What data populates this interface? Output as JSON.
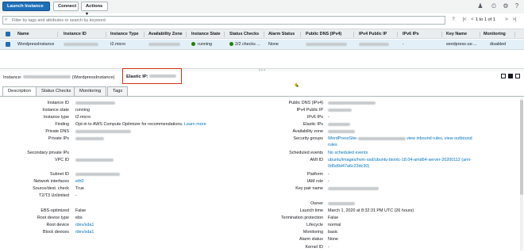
{
  "toolbar": {
    "launch_label": "Launch Instance",
    "connect_label": "Connect",
    "actions_label": "Actions"
  },
  "filter": {
    "placeholder": "Filter by tags and attributes or search by keyword"
  },
  "pager": {
    "text": "1 to 1 of 1"
  },
  "columns": {
    "name": "Name",
    "instance_id": "Instance ID",
    "instance_type": "Instance Type",
    "az": "Availability Zone",
    "state": "Instance State",
    "checks": "Status Checks",
    "alarm": "Alarm Status",
    "public_dns": "Public DNS (IPv4)",
    "ipv4": "IPv4 Public IP",
    "ipv6": "IPv6 IPs",
    "key": "Key Name",
    "monitoring": "Monitoring"
  },
  "row": {
    "name": "WordpressInstance",
    "instance_type": "t2.micro",
    "state": "running",
    "checks": "2/2 checks ...",
    "alarm": "None",
    "ipv6": "-",
    "key": "wordpress-us-...",
    "monitoring": "disabled"
  },
  "detail": {
    "instance_label": "Instance:",
    "instance_name": "(WordpressInstance)",
    "eip_label": "Elastic IP:"
  },
  "tabs": [
    "Description",
    "Status Checks",
    "Monitoring",
    "Tags"
  ],
  "left": {
    "instance_id": "Instance ID",
    "instance_state": "Instance state",
    "instance_state_val": "running",
    "instance_type": "Instance type",
    "instance_type_val": "t2.micro",
    "finding": "Finding",
    "finding_val": "Opt-in to AWS Compute Optimizer for recommendations.",
    "learn_more": "Learn more",
    "private_dns": "Private DNS",
    "private_ips": "Private IPs",
    "secondary_ips": "Secondary private IPs",
    "vpc_id": "VPC ID",
    "subnet_id": "Subnet ID",
    "network_interfaces": "Network interfaces",
    "network_interfaces_val": "eth0",
    "source_dest": "Source/dest. check",
    "source_dest_val": "True",
    "t2t3": "T2/T3 Unlimited",
    "t2t3_val": "-",
    "ebs_opt": "EBS-optimized",
    "ebs_opt_val": "False",
    "root_type": "Root device type",
    "root_type_val": "ebs",
    "root_device": "Root device",
    "root_device_val": "/dev/sda1",
    "block_devices": "Block devices",
    "block_devices_val": "/dev/sda1"
  },
  "right": {
    "public_dns": "Public DNS (IPv4)",
    "ipv4": "IPv4 Public IP",
    "ipv6": "IPv6 IPs",
    "ipv6_val": "-",
    "elastic_ips": "Elastic IPs",
    "az": "Availability zone",
    "security_groups": "Security groups",
    "sg_val": "WordPressSite-",
    "sg_links": "view inbound rules, view outbound",
    "sg_rules": "rules",
    "scheduled": "Scheduled events",
    "scheduled_val": "No scheduled events",
    "ami_id": "AMI ID",
    "ami_val1": "ubuntu/images/hvm-ssd/ubuntu-bionic-18.04-amd64-server-20200112 (ami-",
    "ami_val2": "0d5d9d47a6c23dc30)",
    "platform": "Platform",
    "platform_val": "-",
    "iam_role": "IAM role",
    "iam_role_val": "-",
    "key_pair": "Key pair name",
    "owner": "Owner",
    "launch_time": "Launch time",
    "launch_time_val": "March 1, 2020 at 8:32:31 PM UTC (26 hours)",
    "termination": "Termination protection",
    "termination_val": "False",
    "lifecycle": "Lifecycle",
    "lifecycle_val": "normal",
    "monitoring": "Monitoring",
    "monitoring_val": "basic",
    "alarm_status": "Alarm status",
    "alarm_status_val": "None",
    "kernel_id": "Kernel ID",
    "kernel_id_val": "-"
  },
  "colors": {
    "primary": "#1e6fb8",
    "link": "#0073bb",
    "running": "#1d8102",
    "highlight": "#d13212"
  }
}
